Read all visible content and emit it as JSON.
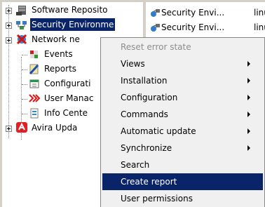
{
  "tree": {
    "items": [
      {
        "label": "Software Reposito",
        "icon": "server-icon",
        "expandable": true
      },
      {
        "label": "Security Environme",
        "icon": "network-icon",
        "expandable": true,
        "selected": true
      },
      {
        "label": "Network ne",
        "icon": "globe-x-icon",
        "expandable": true
      },
      {
        "label": "Events",
        "icon": "events-icon",
        "expandable": false
      },
      {
        "label": "Reports",
        "icon": "reports-icon",
        "expandable": false
      },
      {
        "label": "Configurati",
        "icon": "configuration-icon",
        "expandable": false
      },
      {
        "label": "User Manac",
        "icon": "user-management-icon",
        "expandable": false
      },
      {
        "label": "Info Cente",
        "icon": "info-center-icon",
        "expandable": false
      },
      {
        "label": "Avira Upda",
        "icon": "avira-update-icon",
        "expandable": true
      }
    ]
  },
  "list": {
    "rows": [
      {
        "name": "Security Envi...",
        "type": "linu",
        "icon": "security-env-icon"
      },
      {
        "name": "Security Envi...",
        "type": "linu",
        "icon": "security-env-icon"
      }
    ]
  },
  "context_menu": {
    "items": [
      {
        "label": "Reset error state",
        "disabled": true,
        "submenu": false
      },
      {
        "label": "Views",
        "disabled": false,
        "submenu": true
      },
      {
        "label": "Installation",
        "disabled": false,
        "submenu": true
      },
      {
        "label": "Configuration",
        "disabled": false,
        "submenu": true
      },
      {
        "label": "Commands",
        "disabled": false,
        "submenu": true
      },
      {
        "label": "Automatic update",
        "disabled": false,
        "submenu": true
      },
      {
        "label": "Synchronize",
        "disabled": false,
        "submenu": true
      },
      {
        "label": "Search",
        "disabled": false,
        "submenu": false
      },
      {
        "label": "Create report",
        "disabled": false,
        "submenu": false,
        "highlighted": true
      },
      {
        "label": "User permissions",
        "disabled": false,
        "submenu": false
      }
    ]
  },
  "colors": {
    "selection": "#0a246a",
    "menu_background": "#f0f0f0",
    "disabled_text": "#8d8d8d",
    "chrome": "#d4d0c8"
  },
  "list_right_edge_fragments": [
    "c",
    "c",
    "r"
  ]
}
